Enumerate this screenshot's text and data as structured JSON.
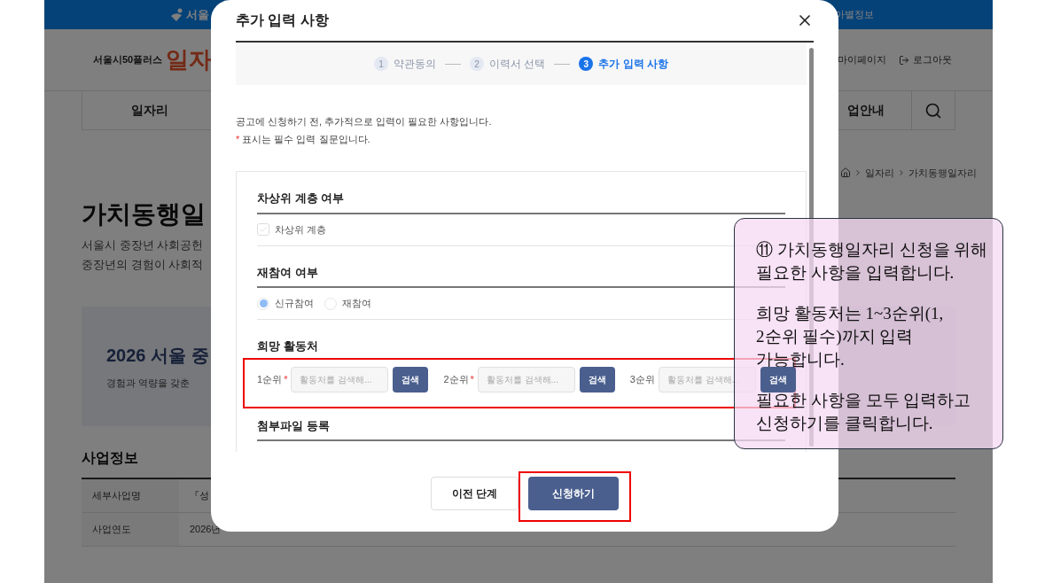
{
  "site": {
    "top_bar_left": "서울",
    "top_bar_right": "아별정보",
    "brand_prefix": "서울시50플러스",
    "brand_name": "일자",
    "user_links": [
      {
        "kind": "mypage",
        "label": "마이페이지"
      },
      {
        "kind": "logout",
        "label": "로그아웃"
      }
    ],
    "nav": [
      "일자리",
      "업안내"
    ],
    "breadcrumb": [
      "일자리",
      "가치동행일자리"
    ],
    "title": "가치동행일",
    "intro": [
      "서울시 중장년 사회공헌",
      "중장년의 경험이 사회적"
    ],
    "banner": {
      "title": "2026 서울 중",
      "text": "경험과 역량을 갖춘"
    },
    "info": {
      "heading": "사업정보",
      "rows": [
        {
          "label": "세부사업명",
          "value": "『성"
        },
        {
          "label": "사업연도",
          "value": "2026년"
        }
      ]
    }
  },
  "modal": {
    "title": "추가 입력 사항",
    "steps": [
      {
        "number": "1",
        "label": "약관동의",
        "selected": false
      },
      {
        "number": "2",
        "label": "이력서 선택",
        "selected": false
      },
      {
        "number": "3",
        "label": "추가 입력 사항",
        "selected": true
      }
    ],
    "intro": "공고에 신청하기 전, 추가적으로 입력이 필요한 사항입니다.",
    "required_note": {
      "mark": "*",
      "text": "표시는 필수 입력 질문입니다."
    },
    "sections": [
      {
        "kind": "checkbox",
        "title": "차상위 계층 여부",
        "options": [
          {
            "label": "차상위 계층",
            "checked": false
          }
        ]
      },
      {
        "kind": "radio",
        "title": "재참여 여부",
        "options": [
          {
            "label": "신규참여",
            "selected": true
          },
          {
            "label": "재참여",
            "selected": false
          }
        ]
      },
      {
        "kind": "search",
        "title": "희망 활동처",
        "slots": [
          {
            "label": "1순위",
            "required": true,
            "placeholder": "활동처를 검색해...",
            "button": "검색"
          },
          {
            "label": "2순위",
            "required": true,
            "placeholder": "활동처를 검색해...",
            "button": "검색"
          },
          {
            "label": "3순위",
            "required": false,
            "placeholder": "활동처를 검색해...",
            "button": "검색"
          }
        ]
      },
      {
        "kind": "upload",
        "title": "첨부파일 등록"
      }
    ],
    "buttons": [
      {
        "kind": "secondary",
        "label": "이전 단계"
      },
      {
        "kind": "primary",
        "label": "신청하기"
      }
    ]
  },
  "callout": {
    "paragraphs": [
      "⑪ 가치동행일자리 신청을 위해 필요한 사항을 입력합니다.",
      "희망 활동처는 1~3순위(1, 2순위 필수)까지 입력 가능합니다.",
      "필요한 사항을 모두 입력하고 신청하기를 클릭합니다."
    ]
  }
}
